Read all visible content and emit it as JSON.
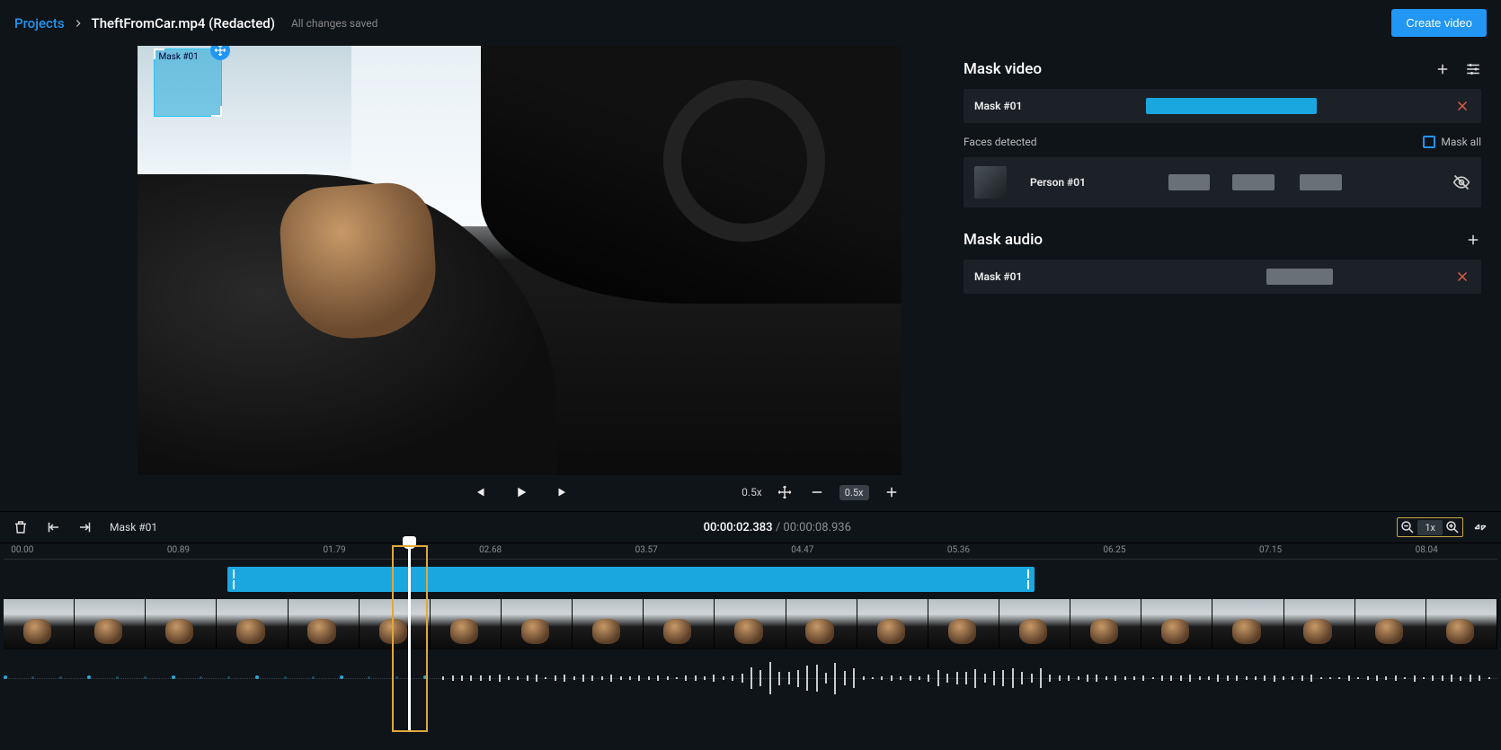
{
  "breadcrumb": {
    "root": "Projects",
    "file": "TheftFromCar.mp4 (Redacted)"
  },
  "header": {
    "save_status": "All changes saved",
    "create_btn": "Create video"
  },
  "overlay": {
    "mask_label": "Mask #01"
  },
  "player": {
    "speed": "0.5x",
    "speed_chip": "0.5x"
  },
  "panel": {
    "mask_video_title": "Mask video",
    "mask_audio_title": "Mask audio",
    "video_mask_label": "Mask #01",
    "faces_detected": "Faces detected",
    "mask_all": "Mask all",
    "person_label": "Person #01",
    "audio_mask_label": "Mask #01"
  },
  "toolbar": {
    "active_mask": "Mask #01"
  },
  "time": {
    "current": "00:00:02.383",
    "total": "00:00:08.936"
  },
  "zoom": {
    "level": "1x"
  },
  "ruler": [
    "00.00",
    "00.89",
    "01.79",
    "02.68",
    "03.57",
    "04.47",
    "05.36",
    "06.25",
    "07.15",
    "08.04"
  ]
}
